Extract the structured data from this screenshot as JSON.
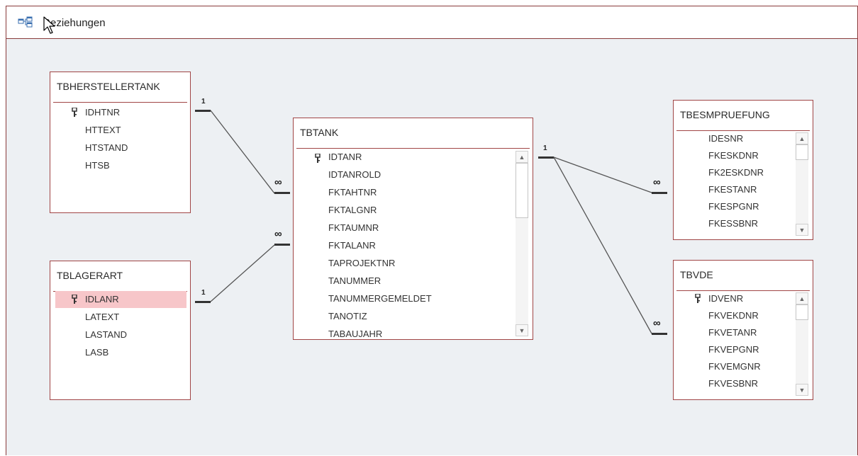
{
  "window": {
    "tab_title": "Beziehungen",
    "tab_icon": "relationships-icon"
  },
  "colors": {
    "table_border": "#a04545",
    "canvas": "#edf0f3",
    "highlight": "#f7c6c9"
  },
  "tables": {
    "tbherstellertank": {
      "title": "TBHERSTELLERTANK",
      "fields": [
        "IDHTNR",
        "HTTEXT",
        "HTSTAND",
        "HTSB"
      ],
      "primary_key": "IDHTNR"
    },
    "tblagerart": {
      "title": "TBLAGERART",
      "fields": [
        "IDLANR",
        "LATEXT",
        "LASTAND",
        "LASB"
      ],
      "primary_key": "IDLANR",
      "selected_field": "IDLANR"
    },
    "tbtank": {
      "title": "TBTANK",
      "fields": [
        "IDTANR",
        "IDTANROLD",
        "FKTAHTNR",
        "FKTALGNR",
        "FKTAUMNR",
        "FKTALANR",
        "TAPROJEKTNR",
        "TANUMMER",
        "TANUMMERGEMELDET",
        "TANOTIZ",
        "TABAUJAHR"
      ],
      "primary_key": "IDTANR"
    },
    "tbesmpruefung": {
      "title": "TBESMPRUEFUNG",
      "fields": [
        "IDESNR",
        "FKESKDNR",
        "FK2ESKDNR",
        "FKESTANR",
        "FKESPGNR",
        "FKESSBNR"
      ]
    },
    "tbvde": {
      "title": "TBVDE",
      "fields": [
        "IDVENR",
        "FKVEKDNR",
        "FKVETANR",
        "FKVEPGNR",
        "FKVEMGNR",
        "FKVESBNR"
      ],
      "primary_key": "IDVENR"
    }
  },
  "relationships": {
    "one": "1",
    "many": "∞"
  }
}
